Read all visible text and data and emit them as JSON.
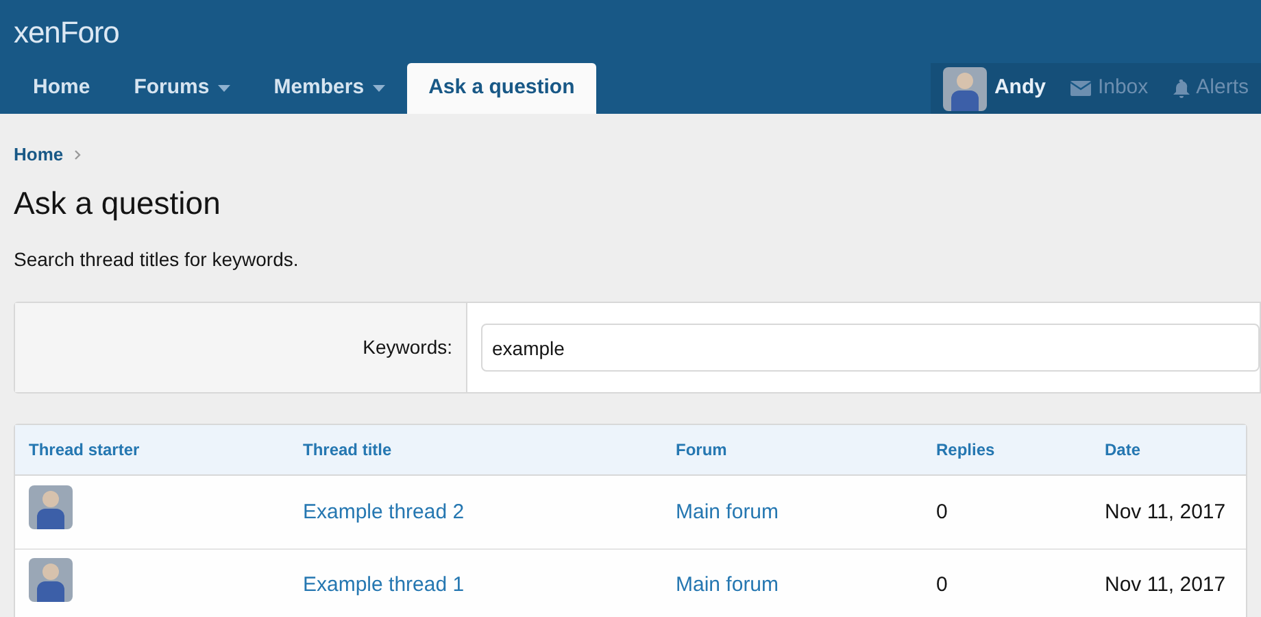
{
  "logo": "xenForo",
  "tabs": [
    {
      "label": "Home",
      "selected": false,
      "menu": false
    },
    {
      "label": "Forums",
      "selected": false,
      "menu": true
    },
    {
      "label": "Members",
      "selected": false,
      "menu": true
    },
    {
      "label": "Ask a question",
      "selected": true,
      "menu": false
    }
  ],
  "user_nav": [
    {
      "kind": "avatar",
      "label": "Andy"
    },
    {
      "kind": "inbox",
      "label": "Inbox"
    },
    {
      "kind": "alerts",
      "label": "Alerts"
    }
  ],
  "breadcrumb": [
    "Home"
  ],
  "title": "Ask a question",
  "description": "Search thread titles for keywords.",
  "form": {
    "label": "Keywords:",
    "value": "example"
  },
  "table": {
    "columns": [
      "Thread starter",
      "Thread title",
      "Forum",
      "Replies",
      "Date"
    ],
    "rows": [
      {
        "title": "Example thread 2",
        "forum": "Main forum",
        "replies": "0",
        "date": "Nov 11, 2017"
      },
      {
        "title": "Example thread 1",
        "forum": "Main forum",
        "replies": "0",
        "date": "Nov 11, 2017"
      }
    ]
  }
}
